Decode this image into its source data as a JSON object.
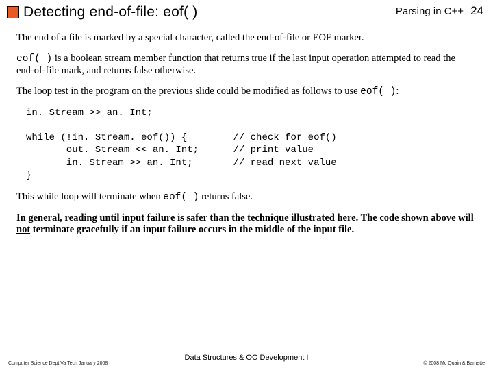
{
  "header": {
    "title": "Detecting end-of-file:  eof( )",
    "parsing": "Parsing in C++",
    "page_number": "24"
  },
  "body": {
    "p1": "The end of a file is marked by a special character, called the end-of-file or EOF marker.",
    "p2_code": "eof( )",
    "p2_rest": " is a boolean stream member function that returns true if the last input operation attempted to read the end-of-file mark, and returns false otherwise.",
    "p3a": "The loop test in the program on the previous slide could be modified as follows to use ",
    "p3_code": "eof( )",
    "p3b": ":",
    "code": "in. Stream >> an. Int;\n\nwhile (!in. Stream. eof()) {        // check for eof()\n       out. Stream << an. Int;      // print value\n       in. Stream >> an. Int;       // read next value\n}",
    "p4a": "This while loop will terminate when ",
    "p4_code": "eof( )",
    "p4b": " returns false.",
    "p5a": "In general, reading until input failure is safer than the technique illustrated here. The code shown above will ",
    "p5_under": "not",
    "p5b": " terminate gracefully if an input failure occurs in the middle of the input file."
  },
  "footer": {
    "left": "Computer Science Dept Va Tech January 2008",
    "center": "Data Structures & OO Development I",
    "right": "© 2008  Mc Quain & Barnette"
  }
}
